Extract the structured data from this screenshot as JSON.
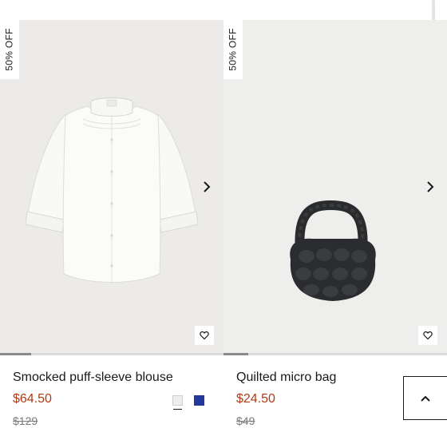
{
  "products": [
    {
      "badge": "50% OFF",
      "name": "Smocked puff-sleeve blouse",
      "price": "$64.50",
      "original_price": "$129",
      "image_icon": "blouse-image",
      "swatches": [
        {
          "color": "#eeeeee",
          "selected": true
        },
        {
          "color": "#23389a",
          "selected": false
        }
      ],
      "carousel_progress": 0.14
    },
    {
      "badge": "50% OFF",
      "name": "Quilted micro bag",
      "price": "$24.50",
      "original_price": "$49",
      "image_icon": "bag-image",
      "carousel_progress": 0.11
    }
  ],
  "icons": {
    "next": "chevron-right-icon",
    "wishlist": "heart-icon",
    "back_to_top": "chevron-up-icon"
  },
  "colors": {
    "sale_price": "#b03a14",
    "text": "#1a1a1a",
    "strike": "#7a7a7a"
  }
}
